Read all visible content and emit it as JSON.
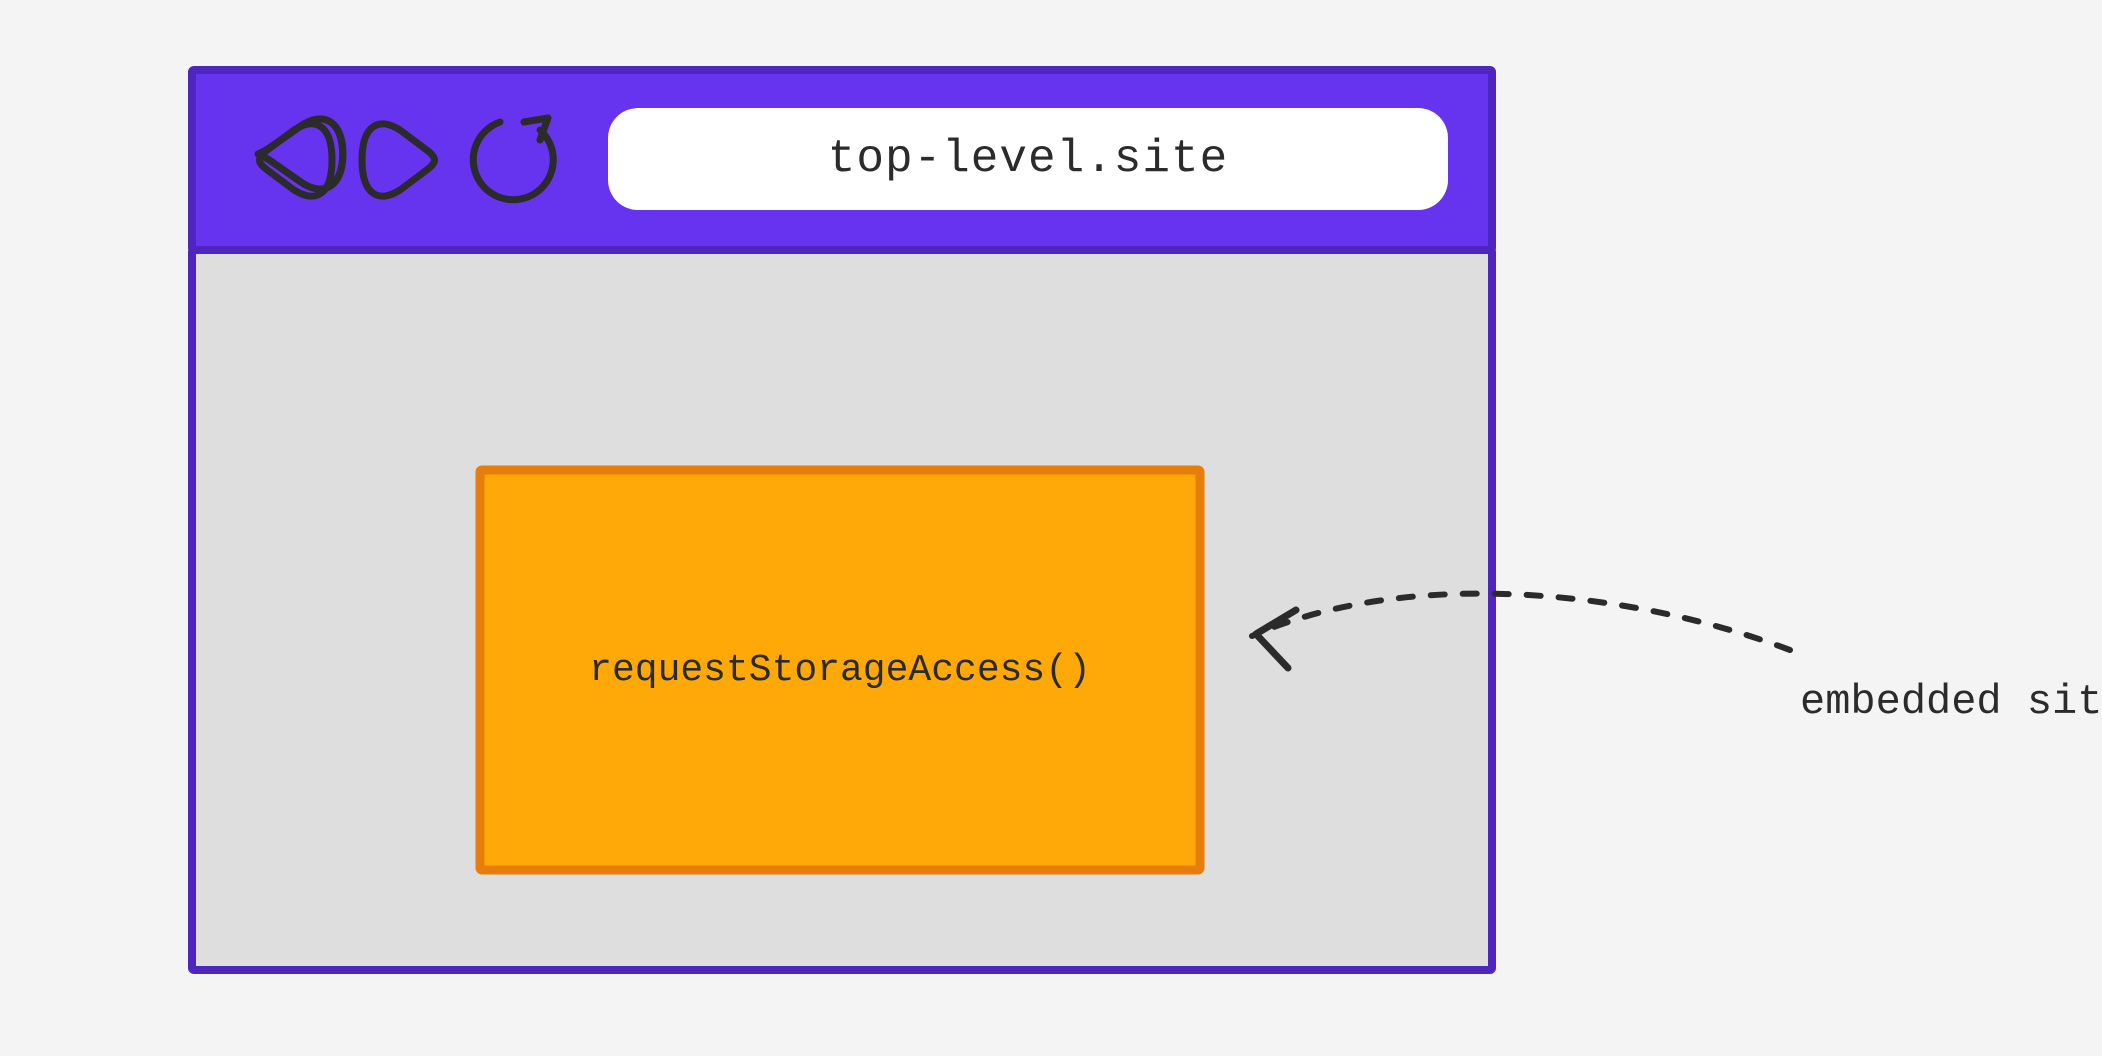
{
  "colors": {
    "purple": "#6633ee",
    "purple_stroke": "#4f25bf",
    "content_bg": "#dedede",
    "embed_fill": "#ffa908",
    "embed_stroke": "#e77d0b",
    "ink": "#2b2b2b",
    "white": "#ffffff"
  },
  "address_bar": {
    "url": "top-level.site"
  },
  "embedded_frame": {
    "api_call": "requestStorageAccess()"
  },
  "annotation": {
    "label": "embedded site"
  }
}
